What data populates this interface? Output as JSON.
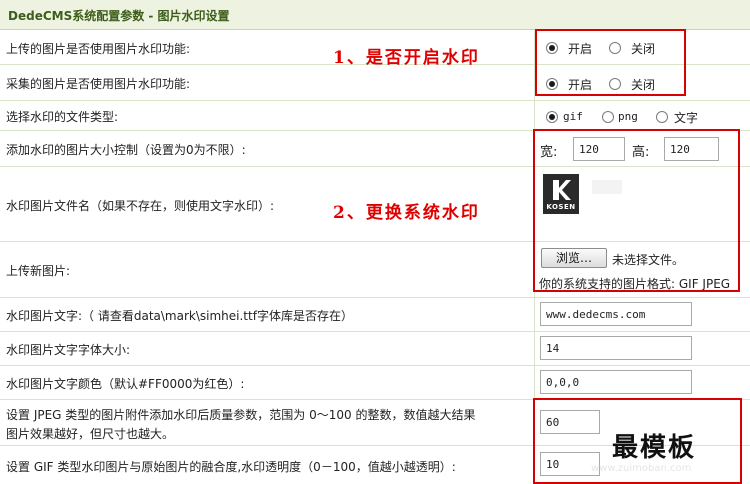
{
  "header": {
    "title": "DedeCMS系统配置参数 - 图片水印设置"
  },
  "rows": {
    "upload_wm": {
      "label": "上传的图片是否使用图片水印功能:",
      "opt_on": "开启",
      "opt_off": "关闭"
    },
    "collect_wm": {
      "label": "采集的图片是否使用图片水印功能:",
      "opt_on": "开启",
      "opt_off": "关闭"
    },
    "file_type": {
      "label": "选择水印的文件类型:",
      "opt_gif": "gif",
      "opt_png": "png",
      "opt_text": "文字"
    },
    "size": {
      "label": "添加水印的图片大小控制（设置为0为不限）:",
      "w_label": "宽:",
      "w_value": "120",
      "h_label": "高:",
      "h_value": "120"
    },
    "wm_file": {
      "label": "水印图片文件名（如果不存在，则使用文字水印）:",
      "logo_text": "KOSEN"
    },
    "upload_new": {
      "label": "上传新图片:",
      "browse_label": "浏览…",
      "no_file": "未选择文件。",
      "formats": "你的系统支持的图片格式: GIF JPEG"
    },
    "wm_text": {
      "label": "水印图片文字:（ 请查看data\\mark\\simhei.ttf字体库是否存在）",
      "value": "www.dedecms.com"
    },
    "font_size": {
      "label": "水印图片文字字体大小:",
      "value": "14"
    },
    "font_color": {
      "label": "水印图片文字颜色（默认#FF0000为红色）:",
      "value": "0,0,0"
    },
    "jpeg_quality": {
      "label_line1": "设置 JPEG 类型的图片附件添加水印后质量参数，范围为 0～100 的整数，数值越大结果",
      "label_line2": "图片效果越好，但尺寸也越大。",
      "value": "60"
    },
    "gif_blend": {
      "label": "设置 GIF 类型水印图片与原始图片的融合度,水印透明度（0－100，值越小越透明）:",
      "value": "10"
    }
  },
  "annotations": {
    "step1": "1、是否开启水印",
    "step2": "2、更换系统水印"
  },
  "watermark": {
    "site_name": "最模板",
    "url": "www.zuimoban.com"
  },
  "colors": {
    "annotation_red": "#e00000",
    "header_bg": "#eef3e1",
    "row_border": "#d8e4c8"
  }
}
